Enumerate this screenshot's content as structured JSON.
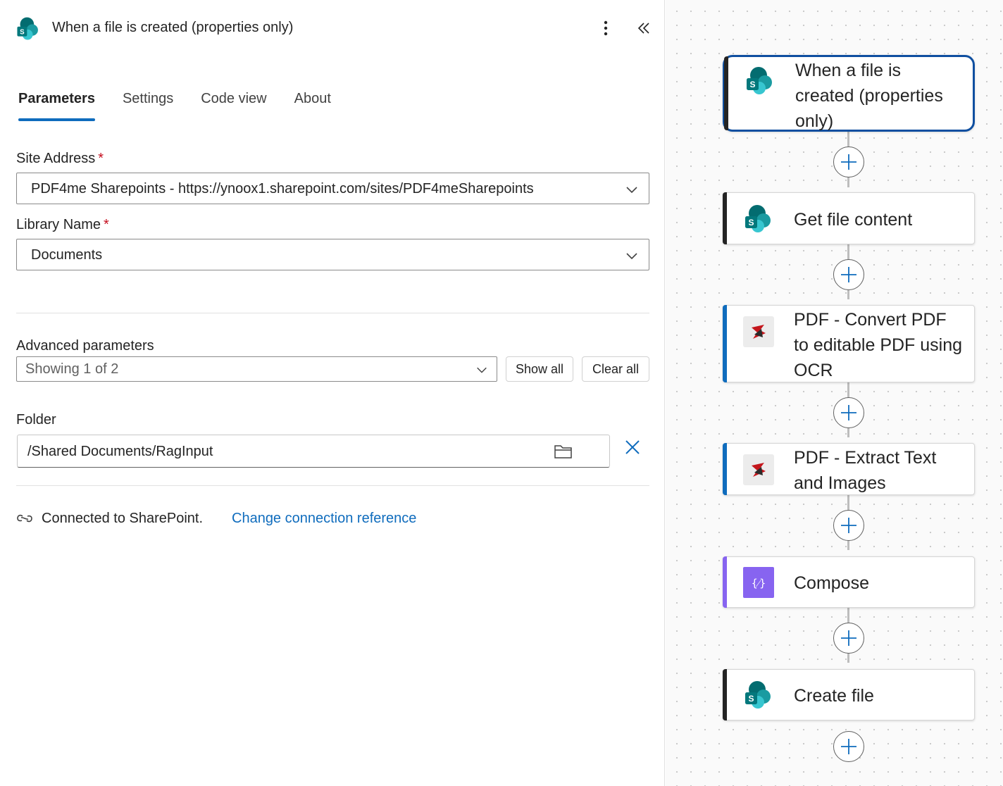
{
  "panel": {
    "title": "When a file is created (properties only)",
    "tabs": [
      {
        "label": "Parameters",
        "active": true
      },
      {
        "label": "Settings",
        "active": false
      },
      {
        "label": "Code view",
        "active": false
      },
      {
        "label": "About",
        "active": false
      }
    ],
    "site_address": {
      "label": "Site Address",
      "required_marker": "*",
      "value": "PDF4me Sharepoints - https://ynoox1.sharepoint.com/sites/PDF4meSharepoints"
    },
    "library_name": {
      "label": "Library Name",
      "required_marker": "*",
      "value": "Documents"
    },
    "advanced": {
      "label": "Advanced parameters",
      "value": "Showing 1 of 2",
      "show_all": "Show all",
      "clear_all": "Clear all"
    },
    "folder": {
      "label": "Folder",
      "value": "/Shared Documents/RagInput"
    },
    "connection": {
      "text": "Connected to SharePoint.",
      "link": "Change connection reference"
    }
  },
  "flow": {
    "steps": [
      {
        "label": "When a file is created (properties only)",
        "icon": "sharepoint-icon",
        "stripe": "#242424",
        "selected": true
      },
      {
        "label": "Get file content",
        "icon": "sharepoint-icon",
        "stripe": "#242424",
        "selected": false
      },
      {
        "label": "PDF - Convert PDF to editable PDF using OCR",
        "icon": "pdf4me-icon",
        "stripe": "#0f6cbd",
        "selected": false
      },
      {
        "label": "PDF - Extract Text and Images",
        "icon": "pdf4me-icon",
        "stripe": "#0f6cbd",
        "selected": false
      },
      {
        "label": "Compose",
        "icon": "compose-icon",
        "stripe": "#8764f0",
        "selected": false
      },
      {
        "label": "Create file",
        "icon": "sharepoint-icon",
        "stripe": "#242424",
        "selected": false
      }
    ]
  },
  "colors": {
    "accent": "#0f6cbd",
    "required": "#c50f1f",
    "selected_border": "#0f4fa0",
    "compose": "#8764f0"
  }
}
